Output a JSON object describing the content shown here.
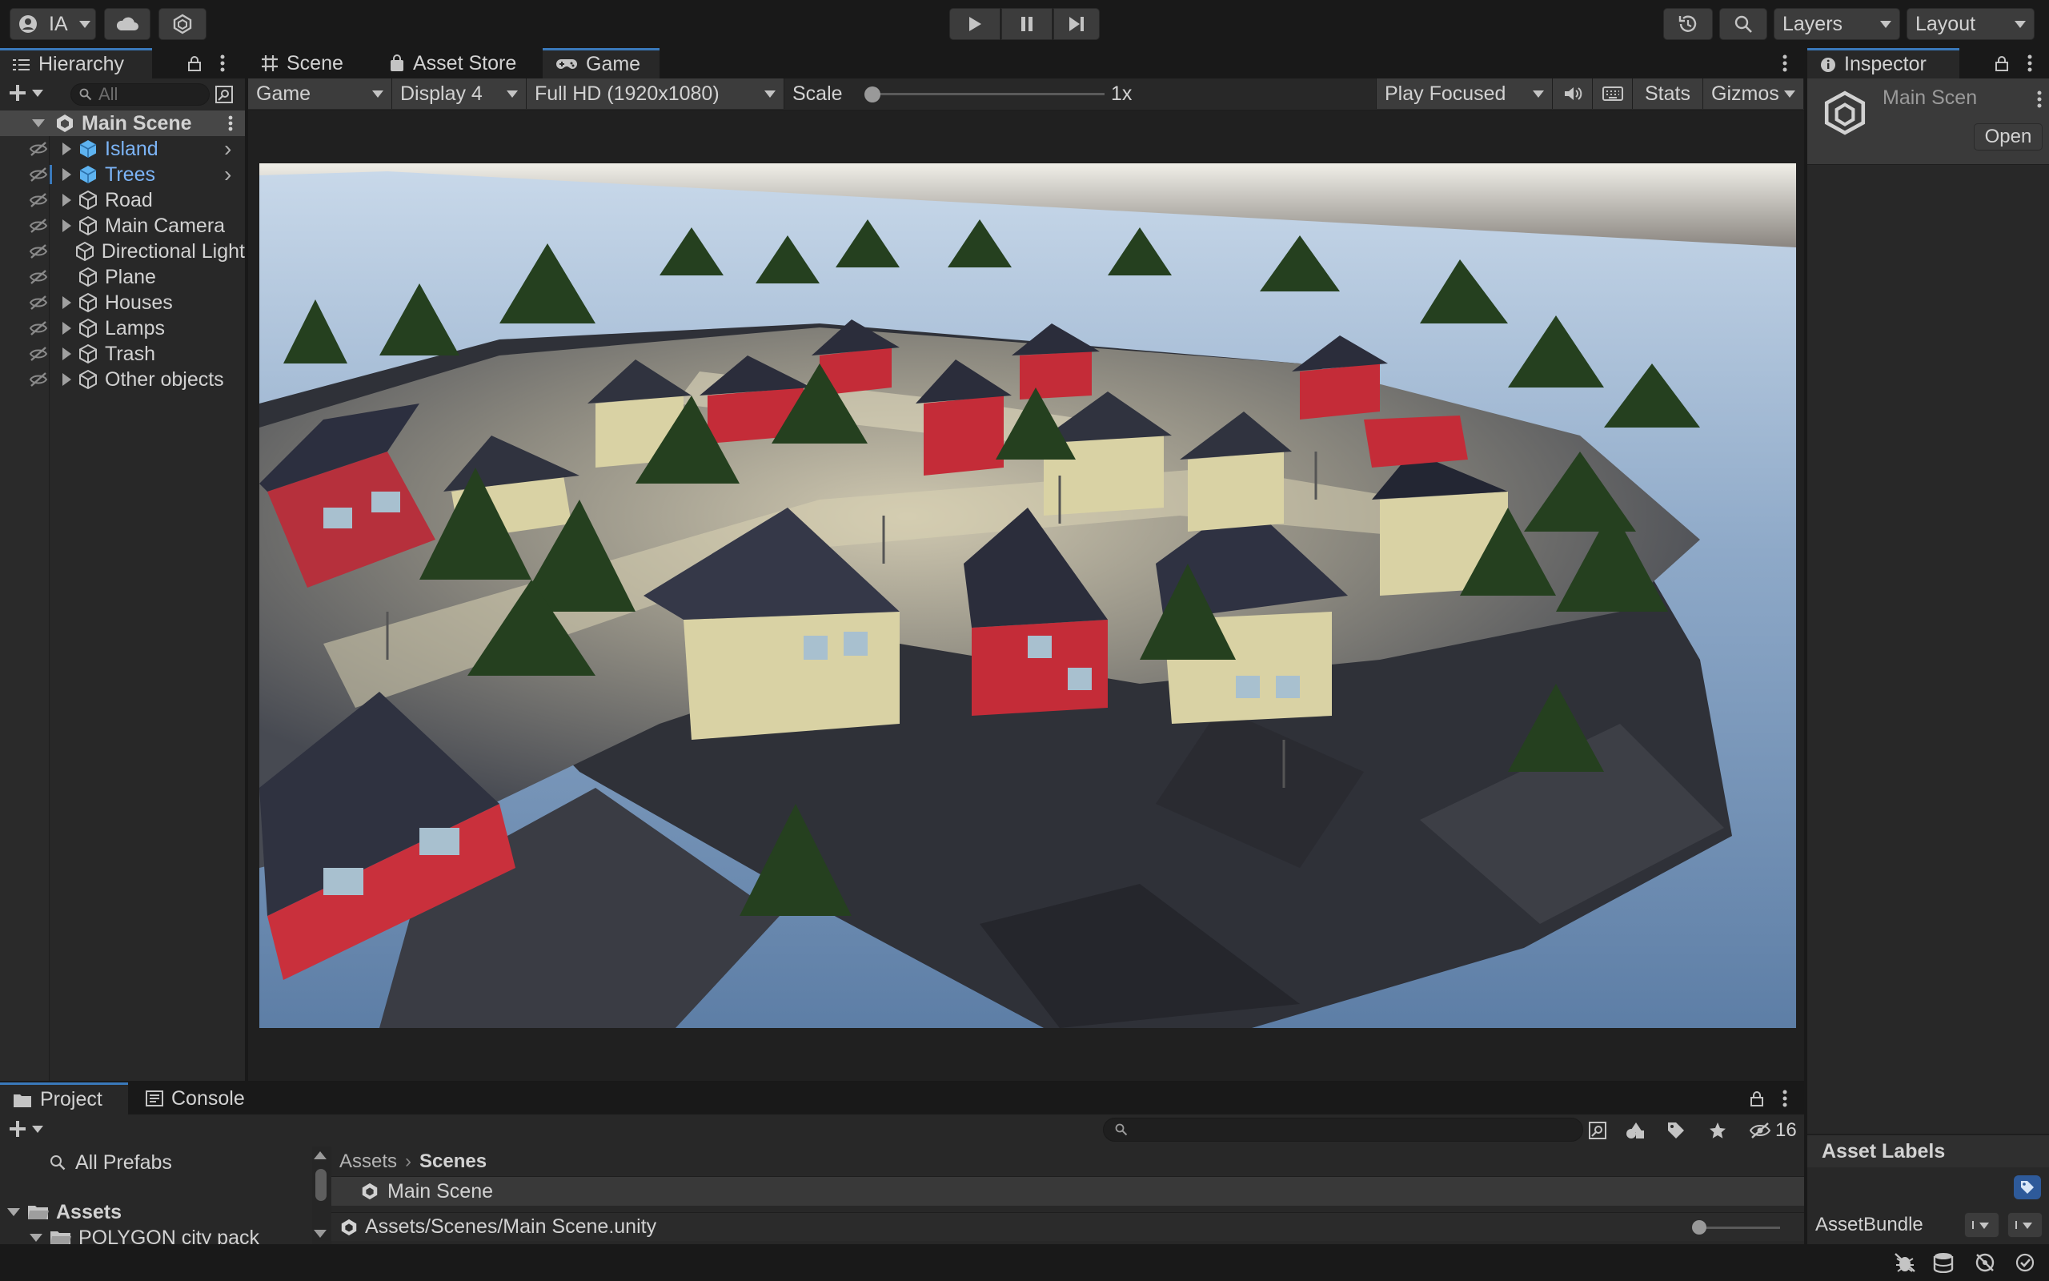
{
  "toolbar": {
    "account_label": "IA",
    "layers_label": "Layers",
    "layout_label": "Layout"
  },
  "hierarchy": {
    "tab_label": "Hierarchy",
    "search_placeholder": "All",
    "scene_name": "Main Scene",
    "items": [
      {
        "label": "Island",
        "prefab": true,
        "expandable": true
      },
      {
        "label": "Trees",
        "prefab": true,
        "expandable": true
      },
      {
        "label": "Road",
        "prefab": false,
        "expandable": true
      },
      {
        "label": "Main Camera",
        "prefab": false,
        "expandable": true
      },
      {
        "label": "Directional Light",
        "prefab": false,
        "expandable": false
      },
      {
        "label": "Plane",
        "prefab": false,
        "expandable": false
      },
      {
        "label": "Houses",
        "prefab": false,
        "expandable": true
      },
      {
        "label": "Lamps",
        "prefab": false,
        "expandable": true
      },
      {
        "label": "Trash",
        "prefab": false,
        "expandable": true
      },
      {
        "label": "Other objects",
        "prefab": false,
        "expandable": true
      }
    ]
  },
  "center_tabs": {
    "scene": "Scene",
    "asset_store": "Asset Store",
    "game": "Game"
  },
  "game_toolbar": {
    "view": "Game",
    "display": "Display 4",
    "resolution": "Full HD (1920x1080)",
    "scale_label": "Scale",
    "scale_value": "1x",
    "scale_fraction": 0.0,
    "play_mode": "Play Focused",
    "stats": "Stats",
    "gizmos": "Gizmos"
  },
  "inspector": {
    "tab_label": "Inspector",
    "object_name": "Main Scen",
    "open_button": "Open",
    "asset_labels": "Asset Labels",
    "asset_bundle": "AssetBundle"
  },
  "project": {
    "tab_project": "Project",
    "tab_console": "Console",
    "hidden_count": "16",
    "all_prefabs": "All Prefabs",
    "assets_root": "Assets",
    "subfolder": "POLYGON city pack",
    "breadcrumb_root": "Assets",
    "breadcrumb_current": "Scenes",
    "file_name": "Main Scene",
    "status_path": "Assets/Scenes/Main Scene.unity"
  },
  "colors": {
    "accent": "#3a79bb",
    "prefab_text": "#7cb4f6",
    "panel": "#282828",
    "toolbar": "#191919"
  }
}
